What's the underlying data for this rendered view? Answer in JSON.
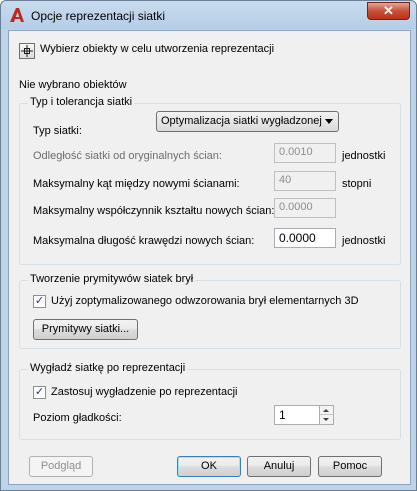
{
  "window": {
    "title": "Opcje reprezentacji siatki",
    "close_glyph": "✕",
    "icon": "autocad-a-icon",
    "accent_color": "#c0281e"
  },
  "selection": {
    "select_objects_label": "Wybierz obiekty w celu utworzenia reprezentacji",
    "status": "Nie wybrano obiektów"
  },
  "mesh_type_group": {
    "title": "Typ i tolerancja siatki",
    "mesh_type_label": "Typ siatki:",
    "mesh_type_value": "Optymalizacja siatki wygładzonej",
    "distance_label": "Odległość siatki od oryginalnych ścian:",
    "distance_value": "0.0010",
    "distance_unit": "jednostki",
    "max_angle_label": "Maksymalny kąt między nowymi ścianami:",
    "max_angle_value": "40",
    "max_angle_unit": "stopni",
    "aspect_ratio_label": "Maksymalny współczynnik kształtu nowych ścian:",
    "aspect_ratio_value": "0.0000",
    "edge_length_label": "Maksymalna długość krawędzi nowych ścian:",
    "edge_length_value": "0.0000",
    "edge_length_unit": "jednostki"
  },
  "primitives_group": {
    "title": "Tworzenie prymitywów siatek brył",
    "use_optimized_label": "Użyj zoptymalizowanego odwzorowania brył elementarnych 3D",
    "use_optimized_checked": true,
    "check_glyph": "✓",
    "primitives_button": "Prymitywy siatki..."
  },
  "smooth_group": {
    "title": "Wygładź siatkę po reprezentacji",
    "apply_smoothing_label": "Zastosuj wygładzenie po reprezentacji",
    "apply_smoothing_checked": true,
    "smoothness_label": "Poziom gładkości:",
    "smoothness_value": "1"
  },
  "footer": {
    "preview": "Podgląd",
    "ok": "OK",
    "cancel": "Anuluj",
    "help": "Pomoc"
  }
}
